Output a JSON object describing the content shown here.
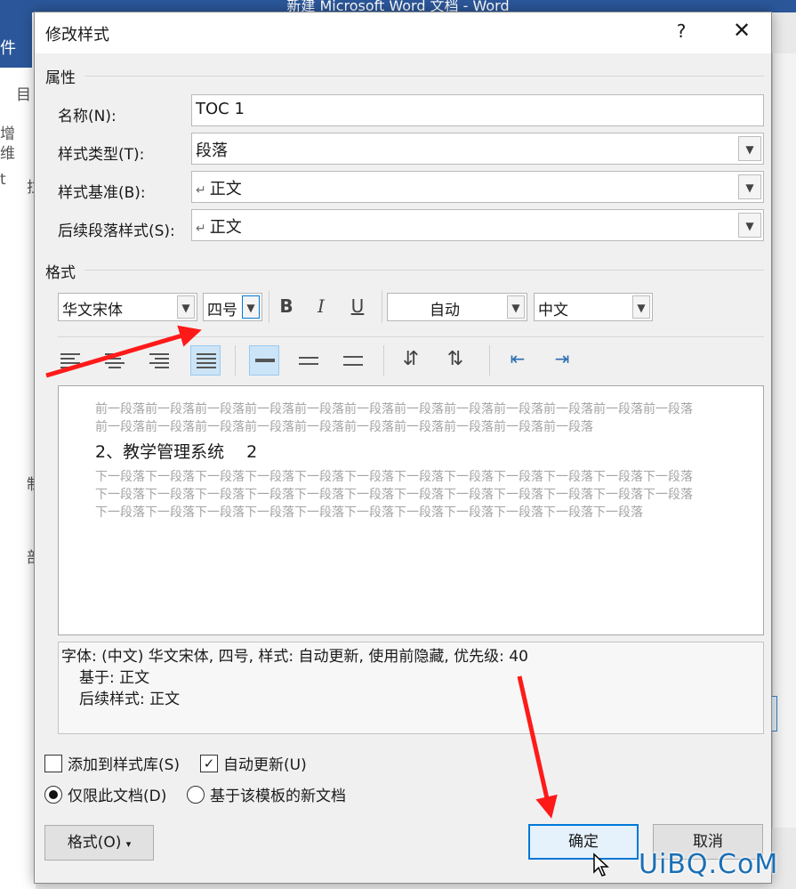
{
  "background": {
    "window_title": "新建 Microsoft Word 文档  -  Word",
    "ribbon_tab_fragment": "件",
    "side_fragments": [
      "目",
      "增",
      "维",
      "t",
      "拉",
      "制",
      "部"
    ]
  },
  "dialog": {
    "title": "修改样式",
    "help_label": "?",
    "close_label": "✕"
  },
  "properties": {
    "heading": "属性",
    "name_label": "名称(N):",
    "name_value": "TOC 1",
    "type_label": "样式类型(T):",
    "type_value": "段落",
    "based_label": "样式基准(B):",
    "based_value": "正文",
    "next_label": "后续段落样式(S):",
    "next_value": "正文",
    "pilcrow": "↵"
  },
  "format": {
    "heading": "格式",
    "font": "华文宋体",
    "size": "四号",
    "bold": "B",
    "italic": "I",
    "underline": "U",
    "color": "自动",
    "language": "中文"
  },
  "preview": {
    "before_text": "前一段落前一段落前一段落前一段落前一段落前一段落前一段落前一段落前一段落前一段落前一段落前一段落前一段落前一段落前一段落前一段落前一段落前一段落前一段落前一段落前一段落前一段落",
    "sample_text": "2、教学管理系统　 2",
    "after_text": "下一段落下一段落下一段落下一段落下一段落下一段落下一段落下一段落下一段落下一段落下一段落下一段落下一段落下一段落下一段落下一段落下一段落下一段落下一段落下一段落下一段落下一段落下一段落下一段落下一段落下一段落下一段落下一段落下一段落下一段落下一段落下一段落下一段落下一段落下一段落"
  },
  "description": {
    "line1": "字体: (中文) 华文宋体, 四号, 样式: 自动更新, 使用前隐藏, 优先级: 40",
    "line2": "基于: 正文",
    "line3": "后续样式: 正文"
  },
  "options": {
    "add_to_gallery": {
      "label": "添加到样式库(S)",
      "checked": false
    },
    "auto_update": {
      "label": "自动更新(U)",
      "checked": true,
      "mark": "✓"
    },
    "this_doc_only": {
      "label": "仅限此文档(D)",
      "selected": true
    },
    "new_docs_template": {
      "label": "基于该模板的新文档",
      "selected": false
    }
  },
  "buttons": {
    "format": "格式(O)",
    "format_caret": "▾",
    "ok": "确定",
    "cancel": "取消"
  },
  "watermark": "UiBQ.CoM",
  "colors": {
    "arrow": "#ff1a1a",
    "accent": "#0078d7",
    "word_blue": "#2b579a"
  }
}
